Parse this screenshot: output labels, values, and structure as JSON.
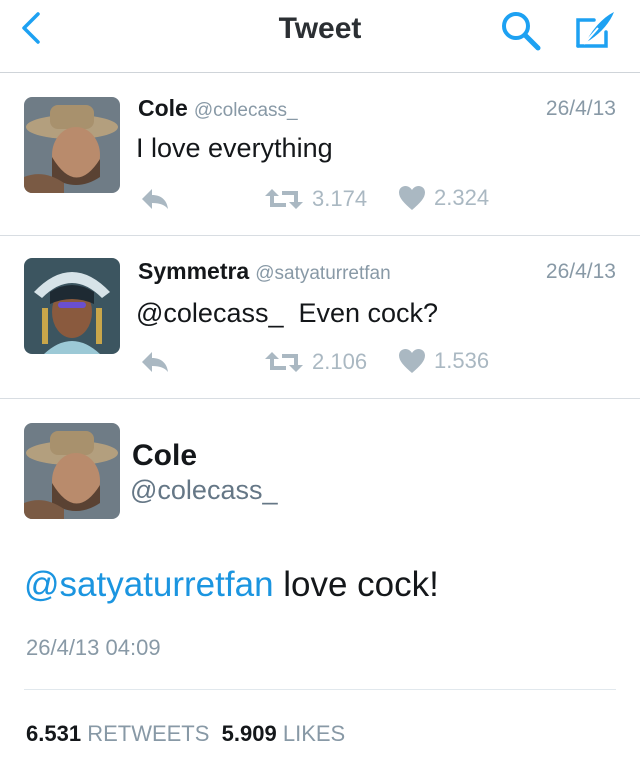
{
  "header": {
    "title": "Tweet",
    "back_icon": "chevron-left-icon",
    "search_icon": "search-icon",
    "compose_icon": "compose-icon",
    "accent_color": "#1da1f2"
  },
  "tweets": [
    {
      "name": "Cole",
      "handle": "@colecass_",
      "date": "26/4/13",
      "text": "I love everything",
      "retweets": "3.174",
      "likes": "2.324"
    },
    {
      "name": "Symmetra",
      "handle": "@satyaturretfan",
      "date": "26/4/13",
      "text": "@colecass_  Even cock?",
      "retweets": "2.106",
      "likes": "1.536"
    }
  ],
  "main_tweet": {
    "name": "Cole",
    "handle": "@colecass_",
    "mention": "@satyaturretfan",
    "text": " love cock!",
    "timestamp": "26/4/13 04:09",
    "retweets_count": "6.531",
    "retweets_label": "RETWEETS",
    "likes_count": "5.909",
    "likes_label": "LIKES"
  }
}
